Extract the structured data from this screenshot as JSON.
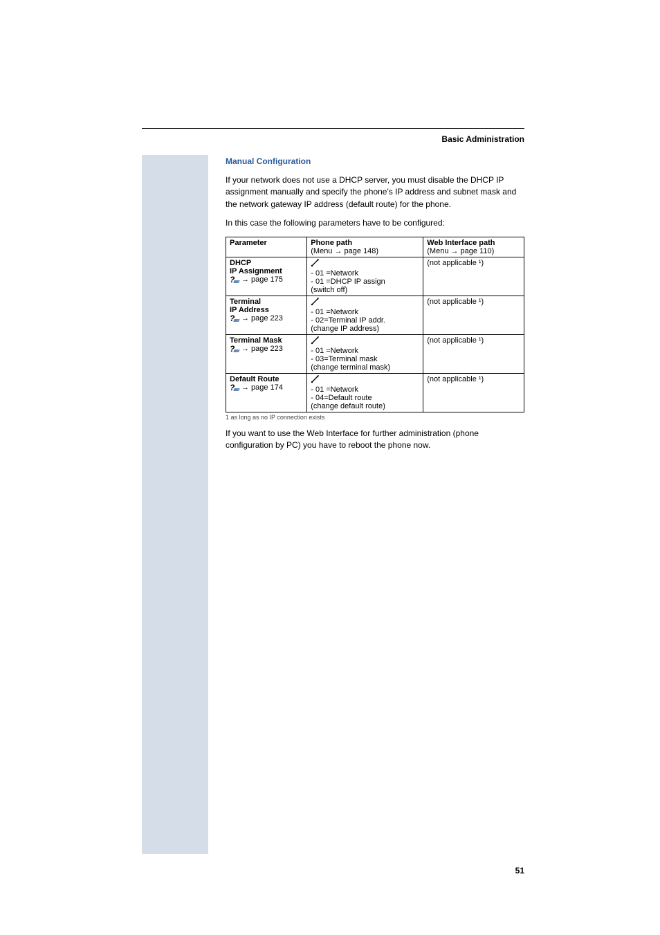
{
  "header": {
    "title": "Basic Administration"
  },
  "section": {
    "heading": "Manual Configuration",
    "intro": "If your network does not use a DHCP server, you must disable the DHCP IP assignment manually and specify the phone's IP address and subnet mask and the network gateway IP address (default route) for the phone.",
    "lead": "In this case the following parameters have to be configured:"
  },
  "table": {
    "headers": {
      "param": "Parameter",
      "phone": "Phone path",
      "phone_sub": "(Menu → page 148)",
      "web": "Web Interface path",
      "web_sub": "(Menu → page 110)"
    },
    "rows": [
      {
        "name1": "DHCP",
        "name2": "IP Assignment",
        "pageref": "page 175",
        "phone_lines": [
          "- 01 =Network",
          "- 01 =DHCP IP assign",
          "(switch off)"
        ],
        "web": "(not applicable ¹)"
      },
      {
        "name1": "Terminal",
        "name2": "IP Address",
        "pageref": "page 223",
        "phone_lines": [
          "- 01 =Network",
          "- 02=Terminal IP addr.",
          "(change IP address)"
        ],
        "web": "(not applicable ¹)"
      },
      {
        "name1": "Terminal Mask",
        "name2": "",
        "pageref": "page 223",
        "phone_lines": [
          "- 01 =Network",
          "- 03=Terminal mask",
          "(change terminal mask)"
        ],
        "web": "(not applicable ¹)"
      },
      {
        "name1": "Default Route",
        "name2": "",
        "pageref": "page 174",
        "phone_lines": [
          "- 01 =Network",
          "- 04=Default route",
          "(change default route)"
        ],
        "web": "(not applicable ¹)"
      }
    ],
    "footnote": "1    as long as no IP connection exists"
  },
  "closing_text": "If you want to use the Web Interface for further administration (phone configuration by PC) you have to reboot the phone now.",
  "page_number": "51"
}
